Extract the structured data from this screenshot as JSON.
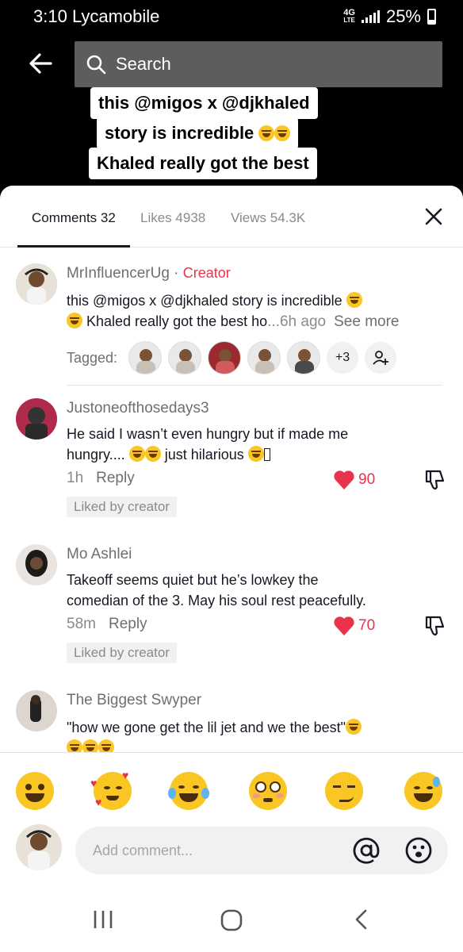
{
  "status_bar": {
    "time": "3:10",
    "carrier": "Lycamobile",
    "network_top": "4G",
    "network_bottom": "LTE",
    "battery": "25%"
  },
  "search": {
    "placeholder": "Search"
  },
  "video_caption": {
    "lines": [
      "this @migos x @djkhaled",
      "story is incredible",
      "Khaled really got the best"
    ]
  },
  "tabs": [
    {
      "label": "Comments",
      "count": "32"
    },
    {
      "label": "Likes",
      "count": "4938"
    },
    {
      "label": "Views",
      "count": "54.3K"
    }
  ],
  "comments": [
    {
      "user": "MrInfluencerUg",
      "badge": "Creator",
      "text_line1": "this @migos x @djkhaled story is incredible",
      "text_line2": " Khaled really got the best ho",
      "time": "...6h ago",
      "see_more": "See more",
      "tagged_label": "Tagged:",
      "tagged_more": "+3"
    },
    {
      "user": "Justoneofthosedays3",
      "text_line1": "He said I wasn’t even hungry but if made me",
      "text_line2": "hungry....",
      "text_line2_tail": " just hilarious",
      "time": "1h",
      "reply": "Reply",
      "likes": "90",
      "liked_by": "Liked by creator"
    },
    {
      "user": "Mo Ashlei",
      "text_line1": "Takeoff seems quiet but he’s lowkey the",
      "text_line2": "comedian of the 3. May his soul rest peacefully.",
      "time": "58m",
      "reply": "Reply",
      "likes": "70",
      "liked_by": "Liked by creator"
    },
    {
      "user": "The Biggest Swyper",
      "text_line1": "\"how we gone get the lil jet and we the best\""
    }
  ],
  "compose": {
    "placeholder": "Add comment..."
  },
  "colors": {
    "accent": "#e8334b",
    "muted": "#8a8a8a",
    "text": "#161823"
  }
}
